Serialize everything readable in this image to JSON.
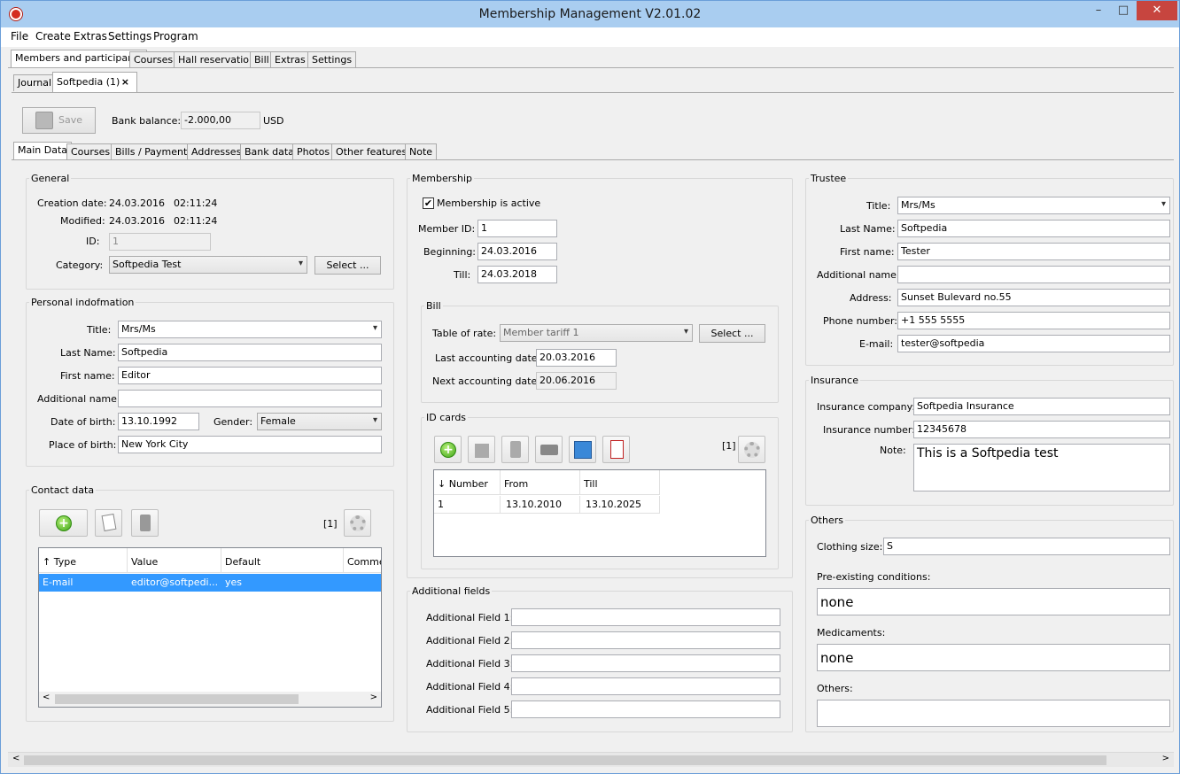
{
  "window": {
    "title": "Membership Management V2.01.02"
  },
  "menu": [
    "File",
    "Create",
    "Extras",
    "Settings",
    "Program"
  ],
  "main_tabs": [
    "Members and participants",
    "Courses",
    "Hall reservation",
    "Bill",
    "Extras",
    "Settings"
  ],
  "sub_tabs": {
    "journal": "Journal",
    "member": "Softpedia (1)",
    "close": "×"
  },
  "toolbar": {
    "save_label": "Save",
    "bank_balance_label": "Bank balance:",
    "bank_balance_value": "-2.000,00",
    "currency": "USD"
  },
  "detail_tabs": [
    "Main Data",
    "Courses",
    "Bills / Payments",
    "Addresses",
    "Bank data",
    "Photos",
    "Other features",
    "Note"
  ],
  "general": {
    "title": "General",
    "creation_label": "Creation date:",
    "creation_date": "24.03.2016",
    "creation_time": "02:11:24",
    "modified_label": "Modified:",
    "modified_date": "24.03.2016",
    "modified_time": "02:11:24",
    "id_label": "ID:",
    "id_value": "1",
    "category_label": "Category:",
    "category_value": "Softpedia Test",
    "select_label": "Select ..."
  },
  "personal": {
    "title": "Personal indofmation",
    "title_label": "Title:",
    "title_value": "Mrs/Ms",
    "last_label": "Last Name:",
    "last_value": "Softpedia",
    "first_label": "First name:",
    "first_value": "Editor",
    "addl_label": "Additional name:",
    "addl_value": "",
    "dob_label": "Date of birth:",
    "dob_value": "13.10.1992",
    "gender_label": "Gender:",
    "gender_value": "Female",
    "pob_label": "Place of birth:",
    "pob_value": "New York City"
  },
  "contact": {
    "title": "Contact data",
    "count": "[1]",
    "columns": [
      "↑ Type",
      "Value",
      "Default",
      "Commen"
    ],
    "rows": [
      [
        "E-mail",
        "editor@softpedi...",
        "yes",
        ""
      ]
    ]
  },
  "membership": {
    "title": "Membership",
    "active_label": "Membership is active",
    "active_check": "✔",
    "member_id_label": "Member ID:",
    "member_id": "1",
    "beginning_label": "Beginning:",
    "beginning": "24.03.2016",
    "till_label": "Till:",
    "till": "24.03.2018"
  },
  "bill": {
    "title": "Bill",
    "rate_label": "Table of rate:",
    "rate_value": "Member tariff 1",
    "select_label": "Select ...",
    "last_label": "Last accounting date:",
    "last_value": "20.03.2016",
    "next_label": "Next accounting date:",
    "next_value": "20.06.2016"
  },
  "id_cards": {
    "title": "ID cards",
    "count": "[1]",
    "columns": [
      "↓ Number",
      "From",
      "Till"
    ],
    "rows": [
      [
        "1",
        "13.10.2010",
        "13.10.2025"
      ]
    ]
  },
  "additional_fields": {
    "title": "Additional fields",
    "labels": [
      "Additional Field 1:",
      "Additional Field 2:",
      "Additional Field 3:",
      "Additional Field 4:",
      "Additional Field 5:"
    ]
  },
  "trustee": {
    "title": "Trustee",
    "title_label": "Title:",
    "title_value": "Mrs/Ms",
    "last_label": "Last Name:",
    "last_value": "Softpedia",
    "first_label": "First name:",
    "first_value": "Tester",
    "addl_label": "Additional name:",
    "addl_value": "",
    "address_label": "Address:",
    "address_value": "Sunset Bulevard no.55",
    "phone_label": "Phone number:",
    "phone_value": "+1 555 5555",
    "email_label": "E-mail:",
    "email_value": "tester@softpedia"
  },
  "insurance": {
    "title": "Insurance",
    "company_label": "Insurance company:",
    "company_value": "Softpedia Insurance",
    "number_label": "Insurance number:",
    "number_value": "12345678",
    "note_label": "Note:",
    "note_value": "This is a Softpedia test"
  },
  "others": {
    "title": "Others",
    "clothing_label": "Clothing size:",
    "clothing_value": "S",
    "conditions_label": "Pre-existing conditions:",
    "conditions_value": "none",
    "medicaments_label": "Medicaments:",
    "medicaments_value": "none",
    "others_label": "Others:",
    "others_value": ""
  },
  "window_controls": {
    "minimize": "–",
    "maximize": "□",
    "close": "✕"
  },
  "scroll_arrows": {
    "left": "<",
    "right": ">",
    "down": "▾"
  },
  "colors": {
    "titlebar": "#a9cdf0",
    "selection": "#3399ff",
    "close": "#c7453f"
  }
}
